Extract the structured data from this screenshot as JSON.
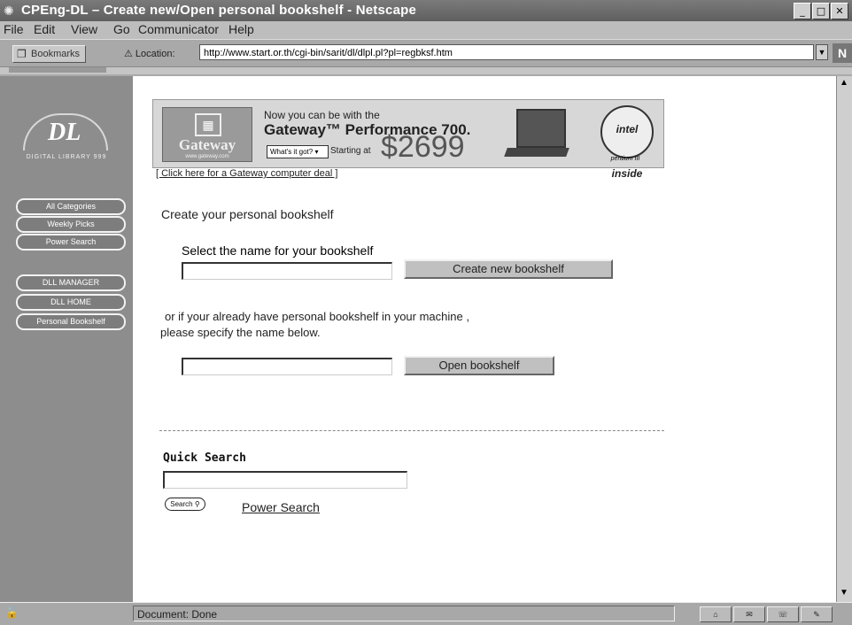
{
  "window": {
    "title": "CPEng-DL – Create new/Open personal bookshelf - Netscape",
    "app_icon": "netscape-icon",
    "controls": {
      "minimize": "_",
      "maximize": "□",
      "close": "✕"
    }
  },
  "menu": [
    "File",
    "Edit",
    "View",
    "Go",
    "Communicator",
    "Help"
  ],
  "toolbar": {
    "bookmarks_label": "Bookmarks",
    "location_label": "Location:",
    "url": "http://www.start.or.th/cgi-bin/sarit/dl/dlpl.pl?pl=regbksf.htm"
  },
  "sidebar": {
    "logo_text": "DL",
    "logo_subtitle": "DIGITAL LIBRARY 999",
    "items": [
      {
        "label": "All Categories"
      },
      {
        "label": "Weekly Picks"
      },
      {
        "label": "Power Search"
      },
      {
        "label": "DLL MANAGER"
      },
      {
        "label": "DLL HOME"
      },
      {
        "label": "Personal Bookshelf"
      }
    ]
  },
  "banner": {
    "brand": "Gateway",
    "brand_url": "www.gateway.com",
    "line1": "Now you can be with the",
    "line2": "Gateway™ Performance 700.",
    "dropdown_label": "What's it got?",
    "starting_label": "Starting at",
    "price": "$2699",
    "intel_label": "intel inside",
    "intel_sub": "pentium III"
  },
  "main": {
    "deal_link": "[ Click here for a Gateway computer deal ]",
    "heading": "Create your personal bookshelf",
    "create": {
      "label": "Select the name for your bookshelf",
      "input_value": "",
      "button": "Create new bookshelf"
    },
    "open": {
      "text_line1": "or if your already have personal bookshelf in your machine ,",
      "text_line2": "please specify the name below.",
      "input_value": "",
      "button": "Open bookshelf"
    },
    "quick_search": {
      "label": "Quick Search",
      "input_value": "",
      "button": "Search",
      "power_link": "Power Search"
    }
  },
  "status": {
    "text": "Document: Done"
  }
}
